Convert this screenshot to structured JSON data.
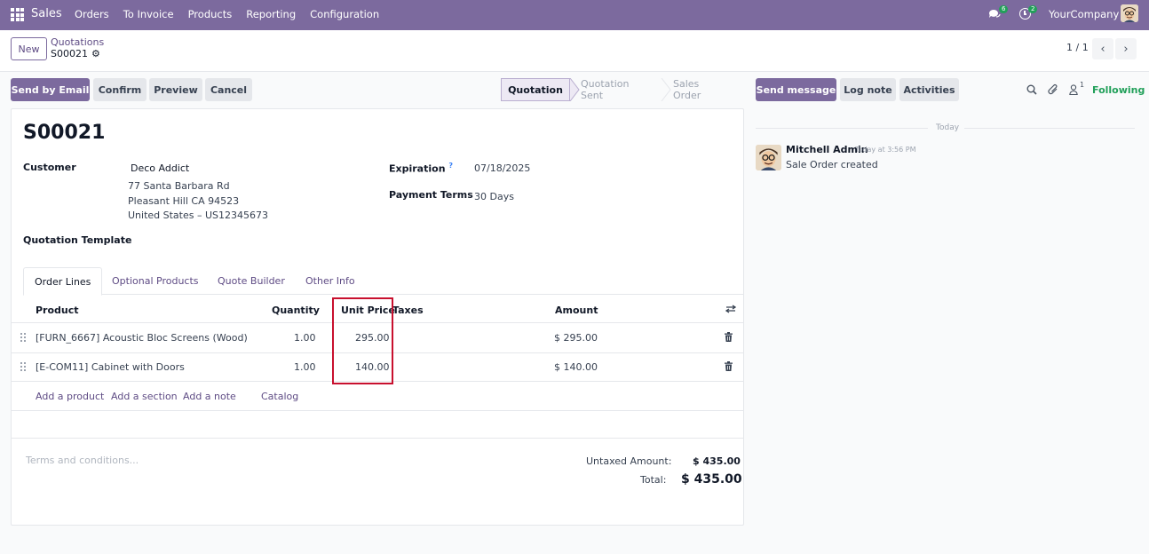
{
  "navbar": {
    "app_name": "Sales",
    "menu": [
      "Orders",
      "To Invoice",
      "Products",
      "Reporting",
      "Configuration"
    ],
    "messages_badge": "6",
    "activities_badge": "2",
    "company": "YourCompany"
  },
  "control_panel": {
    "new_label": "New",
    "breadcrumb_parent": "Quotations",
    "breadcrumb_current": "S00021",
    "pager": "1 / 1"
  },
  "actions": {
    "send_email": "Send by Email",
    "confirm": "Confirm",
    "preview": "Preview",
    "cancel": "Cancel"
  },
  "statusbar": {
    "steps": [
      "Quotation",
      "Quotation Sent",
      "Sales Order"
    ],
    "active": "Quotation"
  },
  "form": {
    "name": "S00021",
    "customer_label": "Customer",
    "customer_name": "Deco Addict",
    "address_line1": "77 Santa Barbara Rd",
    "address_line2": "Pleasant Hill CA 94523",
    "address_line3": "United States – US12345673",
    "expiration_label": "Expiration",
    "expiration_help": "?",
    "expiration_value": "07/18/2025",
    "payment_terms_label": "Payment Terms",
    "payment_terms_value": "30 Days",
    "template_label": "Quotation Template"
  },
  "tabs": [
    "Order Lines",
    "Optional Products",
    "Quote Builder",
    "Other Info"
  ],
  "order_lines": {
    "columns": {
      "product": "Product",
      "quantity": "Quantity",
      "unit_price": "Unit Price",
      "taxes": "Taxes",
      "amount": "Amount"
    },
    "rows": [
      {
        "product": "[FURN_6667] Acoustic Bloc Screens (Wood)",
        "quantity": "1.00",
        "unit_price": "295.00",
        "taxes": "",
        "amount": "$ 295.00"
      },
      {
        "product": "[E-COM11] Cabinet with Doors",
        "quantity": "1.00",
        "unit_price": "140.00",
        "taxes": "",
        "amount": "$ 140.00"
      }
    ],
    "add_links": [
      "Add a product",
      "Add a section",
      "Add a note",
      "Catalog"
    ]
  },
  "footer": {
    "terms_placeholder": "Terms and conditions...",
    "untaxed_label": "Untaxed Amount:",
    "untaxed_value": "$ 435.00",
    "total_label": "Total:",
    "total_value": "$ 435.00"
  },
  "chatter": {
    "send_message": "Send message",
    "log_note": "Log note",
    "activities": "Activities",
    "followers_count": "1",
    "following": "Following",
    "date_separator": "Today",
    "message": {
      "author": "Mitchell Admin",
      "time": "Today at 3:56 PM",
      "body": "Sale Order created"
    }
  },
  "colors": {
    "navbar": "#7c6a9e",
    "primary": "#7c6a9e",
    "link": "#5e4b84",
    "following": "#22a05a",
    "highlight": "#c8102e"
  }
}
